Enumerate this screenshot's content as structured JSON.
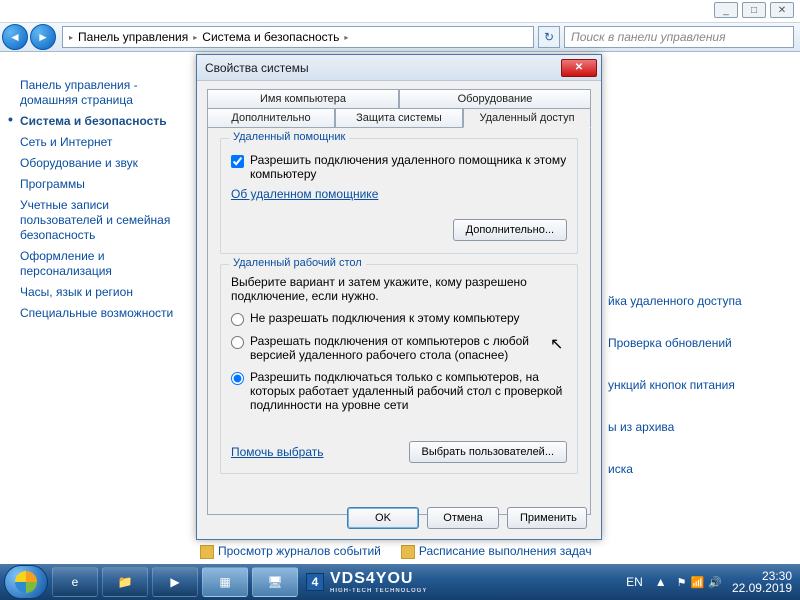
{
  "topicons": {
    "min": "_",
    "max": "□",
    "close": "✕"
  },
  "nav": {
    "back": "◄",
    "fwd": "►",
    "crumbs": [
      "Панель управления",
      "Система и безопасность"
    ],
    "sep": "▸",
    "refresh": "↻",
    "search_placeholder": "Поиск в панели управления"
  },
  "sidebar": {
    "home": "Панель управления - домашняя страница",
    "items": [
      "Система и безопасность",
      "Сеть и Интернет",
      "Оборудование и звук",
      "Программы",
      "Учетные записи пользователей и семейная безопасность",
      "Оформление и персонализация",
      "Часы, язык и регион",
      "Специальные возможности"
    ]
  },
  "rightlinks": {
    "a": "йка удаленного доступа",
    "b": "Проверка обновлений",
    "c": "ункций кнопок питания",
    "d": "ы из архива",
    "e": "иска"
  },
  "bottomlinks": {
    "a": "Просмотр журналов событий",
    "b": "Расписание выполнения задач"
  },
  "dialog": {
    "title": "Свойства системы",
    "close": "✕",
    "tabs": {
      "r1": [
        "Имя компьютера",
        "Оборудование"
      ],
      "r2": [
        "Дополнительно",
        "Защита системы",
        "Удаленный доступ"
      ]
    },
    "group1": {
      "legend": "Удаленный помощник",
      "chk_label": "Разрешить подключения удаленного помощника к этому компьютеру",
      "link": "Об удаленном помощнике",
      "btn": "Дополнительно..."
    },
    "group2": {
      "legend": "Удаленный рабочий стол",
      "intro": "Выберите вариант и затем укажите, кому разрешено подключение, если нужно.",
      "opt1": "Не разрешать подключения к этому компьютеру",
      "opt2": "Разрешать подключения от компьютеров с любой версией удаленного рабочего стола (опаснее)",
      "opt3": "Разрешить подключаться только с компьютеров, на которых работает удаленный рабочий стол с проверкой подлинности на уровне сети",
      "help": "Помочь выбрать",
      "users_btn": "Выбрать пользователей..."
    },
    "buttons": {
      "ok": "OK",
      "cancel": "Отмена",
      "apply": "Применить"
    }
  },
  "taskbar": {
    "brand_num": "4",
    "brand_text": "VDS4YOU",
    "brand_sub": "HIGH-TECH TECHNOLOGY",
    "lang": "EN",
    "tray_up": "▲",
    "time": "23:30",
    "date": "22.09.2019"
  }
}
